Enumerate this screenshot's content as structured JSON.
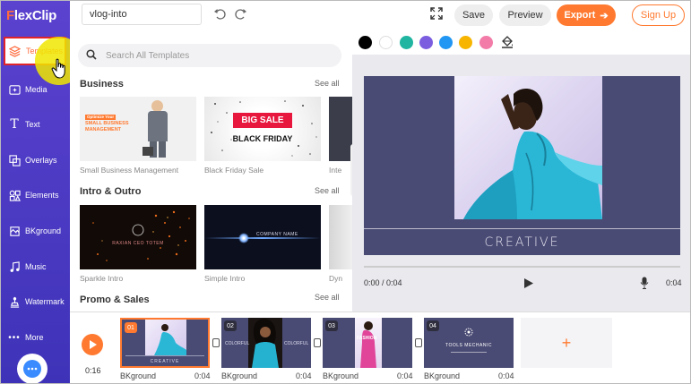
{
  "app": {
    "logo": "FlexClip"
  },
  "sidebar": {
    "items": [
      {
        "label": "Templates",
        "icon": "layers-icon",
        "active": true
      },
      {
        "label": "Media",
        "icon": "media-icon"
      },
      {
        "label": "Text",
        "icon": "text-icon"
      },
      {
        "label": "Overlays",
        "icon": "overlays-icon"
      },
      {
        "label": "Elements",
        "icon": "elements-icon"
      },
      {
        "label": "BKground",
        "icon": "background-icon"
      },
      {
        "label": "Music",
        "icon": "music-icon"
      },
      {
        "label": "Watermark",
        "icon": "watermark-icon"
      },
      {
        "label": "More",
        "icon": "more-icon"
      }
    ]
  },
  "topbar": {
    "project_name": "vlog-into",
    "save_label": "Save",
    "preview_label": "Preview",
    "export_label": "Export",
    "signup_label": "Sign Up"
  },
  "search": {
    "placeholder": "Search All Templates"
  },
  "sections": [
    {
      "title": "Business",
      "see_all": "See all",
      "items": [
        {
          "caption": "Small Business Management",
          "thumb_text": [
            "Optimize Your",
            "SMALL BUSINESS",
            "MANAGEMENT"
          ]
        },
        {
          "caption": "Black Friday Sale",
          "thumb_text": [
            "BIG SALE",
            "BLACK FRIDAY"
          ]
        },
        {
          "caption": "Inte"
        }
      ]
    },
    {
      "title": "Intro & Outro",
      "see_all": "See all",
      "items": [
        {
          "caption": "Sparkle Intro",
          "thumb_text": [
            "RAXIAN CEO TOTEM"
          ]
        },
        {
          "caption": "Simple Intro",
          "thumb_text": [
            "COMPANY NAME"
          ]
        },
        {
          "caption": "Dyn"
        }
      ]
    },
    {
      "title": "Promo & Sales",
      "see_all": "See all"
    }
  ],
  "palette": [
    "#000000",
    "#ffffff",
    "#1fb5a0",
    "#7b5ee0",
    "#2196f3",
    "#f7b500",
    "#f27ba8"
  ],
  "canvas": {
    "title_text": "CREATIVE",
    "current_time": "0:00 / 0:04",
    "duration": "0:04"
  },
  "timeline": {
    "total": "0:16",
    "scenes": [
      {
        "num": "01",
        "label": "BKground",
        "duration": "0:04",
        "text": "CREATIVE"
      },
      {
        "num": "02",
        "label": "BKground",
        "duration": "0:04",
        "text": "COLORFUL"
      },
      {
        "num": "03",
        "label": "BKground",
        "duration": "0:04",
        "text": "FASHION"
      },
      {
        "num": "04",
        "label": "BKground",
        "duration": "0:04",
        "text": "TOOLS MECHANIC"
      }
    ]
  }
}
